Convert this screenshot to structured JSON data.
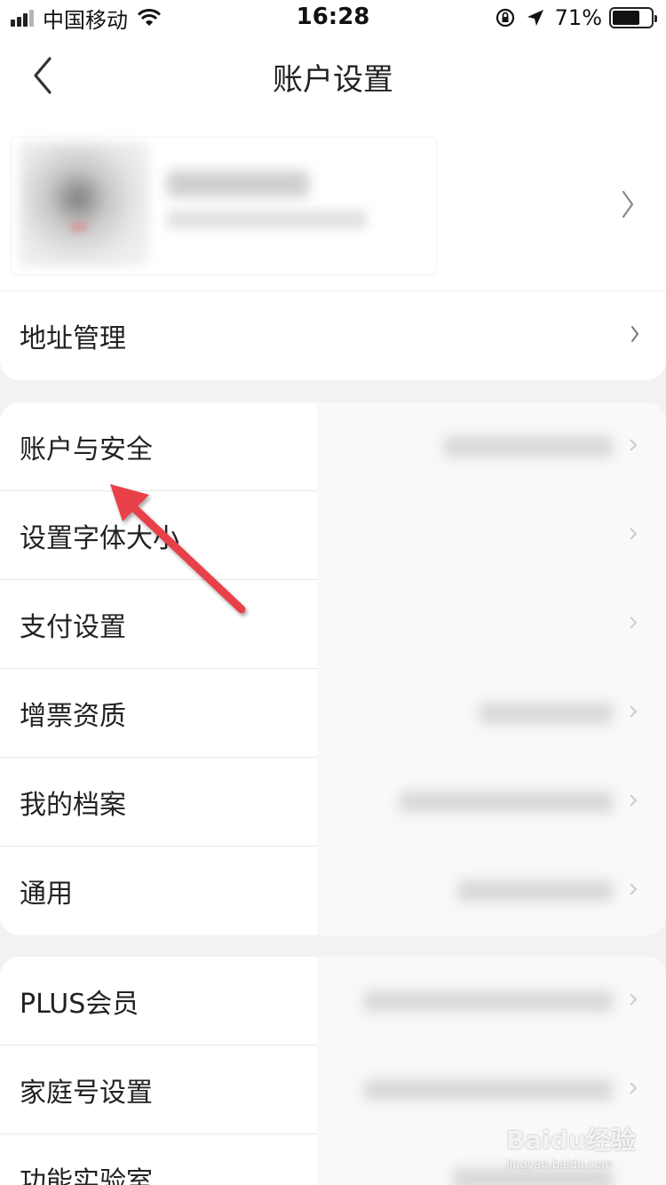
{
  "status_bar": {
    "carrier": "中国移动",
    "time": "16:28",
    "battery_percent": "71%",
    "battery_level": 0.71,
    "icons": [
      "signal-icon",
      "wifi-icon",
      "rotation-lock-icon",
      "location-icon",
      "battery-icon"
    ]
  },
  "nav": {
    "title": "账户设置",
    "back_icon": "chevron-left-icon"
  },
  "profile": {
    "avatar_icon": "avatar",
    "chevron_icon": "chevron-right-icon"
  },
  "sections": {
    "address": "地址管理",
    "main_items": [
      "账户与安全",
      "设置字体大小",
      "支付设置",
      "增票资质",
      "我的档案",
      "通用"
    ],
    "bottom_items": [
      "PLUS会员",
      "家庭号设置",
      "功能实验室"
    ]
  },
  "annotation": {
    "arrow_color": "#e8414a"
  },
  "watermark": {
    "logo": "Baidu经验",
    "url": "jingyan.baidu.com"
  },
  "colors": {
    "background": "#f2f2f2",
    "card": "#ffffff",
    "text": "#222222",
    "chevron": "#8a8a8a"
  }
}
